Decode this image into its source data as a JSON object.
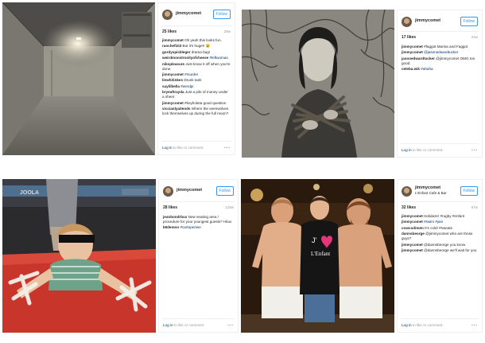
{
  "posts": [
    {
      "user": "jimmycomet",
      "location": "",
      "follow_label": "Follow",
      "likes": "25 likes",
      "time": "28w",
      "comments": [
        {
          "user": "jimmycomet",
          "text": "Oh yeah this looks fun."
        },
        {
          "user": "raochef103",
          "text": "But it's huge!! 😮"
        },
        {
          "user": "gordyspickleger",
          "text": "drama bag!"
        },
        {
          "user": "weirdmonstrosityofcheese",
          "text": "#leftwoman"
        },
        {
          "user": "nikspleasure",
          "text": "Just know it off when you're done."
        },
        {
          "user": "jimmycomet",
          "text": "#murder"
        },
        {
          "user": "liewhitinkes",
          "text": "Drunk tank"
        },
        {
          "user": "saylilbella",
          "text": "#werdpi"
        },
        {
          "user": "bryeaftrayda",
          "text": "Just a pile of money under a sheet"
        },
        {
          "user": "jimmycomet",
          "text": "#keyholeta good question"
        },
        {
          "user": "viccianlyaitends",
          "text": "Where the werewolves lock themselves up during the full moon?"
        }
      ],
      "login_text": "Log in",
      "footer_rest": " to like or comment.",
      "more": "•••"
    },
    {
      "user": "jimmycomet",
      "location": "",
      "follow_label": "Follow",
      "likes": "17 likes",
      "time": "21w",
      "comments": [
        {
          "user": "jimmycomet",
          "text": "#faggot Marina and Faggot"
        },
        {
          "user": "jimmycomet",
          "text": "@jasonedwardtucker"
        },
        {
          "user": "jasonedwardtucker",
          "text": "@jimmycomet OMG too good."
        },
        {
          "user": "celeba.wik",
          "text": "#ahaha"
        }
      ],
      "login_text": "Log in",
      "footer_rest": " to like or comment.",
      "more": "•••"
    },
    {
      "user": "jimmycomet",
      "location": "",
      "follow_label": "Follow",
      "likes": "28 likes",
      "time": "128w",
      "comments": [
        {
          "user": "jeanbondrbux",
          "text": "New seating area / procedure for your youngest guests? Hilux"
        },
        {
          "user": "k8demon",
          "text": "#cartoperiwe"
        }
      ],
      "login_text": "Log in",
      "footer_rest": " to like or comment.",
      "more": "•••"
    },
    {
      "user": "jimmycomet",
      "location": "L'Enfant Cafe & Bar",
      "follow_label": "Follow",
      "likes": "32 likes",
      "time": "57w",
      "comments": [
        {
          "user": "jimmycomet",
          "text": "Holidaze! #rugby #enfant"
        },
        {
          "user": "jimmycomet",
          "text": "#swim #jam"
        },
        {
          "user": "cowcodimen",
          "text": "It's cold! #sweats"
        },
        {
          "user": "dannsbeorge",
          "text": "@jimmycomet who are those guys?"
        },
        {
          "user": "jimmycomet",
          "text": "@dannsbeorge you know"
        },
        {
          "user": "jimmycomet",
          "text": "@dannsbeorge we'll wait for you"
        }
      ],
      "login_text": "Log in",
      "footer_rest": " to like or comment.",
      "more": "•••"
    }
  ],
  "photo3": {
    "brand": "JOOLA"
  },
  "photo4": {
    "shirt_text_1": "J'",
    "shirt_text_2": "L'Enfant"
  }
}
